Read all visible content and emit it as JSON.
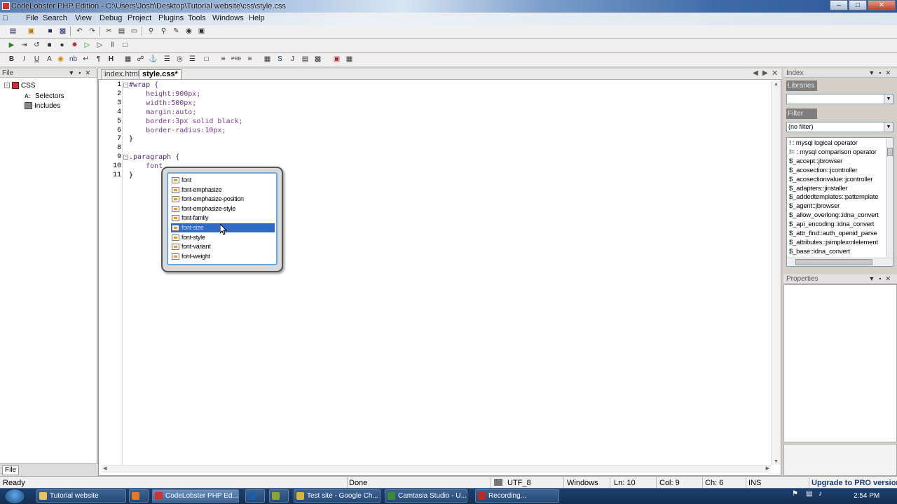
{
  "window": {
    "title": "CodeLobster PHP Edition - C:\\Users\\Josh\\Desktop\\Tutorial website\\css\\style.css"
  },
  "menu": [
    "File",
    "Edit",
    "Search",
    "View",
    "Debug",
    "Project",
    "Plugins",
    "Tools",
    "Windows",
    "Help"
  ],
  "left_panel": {
    "title": "File",
    "tree": [
      {
        "label": "CSS"
      },
      {
        "label": "Selectors"
      },
      {
        "label": "Includes"
      }
    ],
    "bottom_tab": "File"
  },
  "editor": {
    "tabs": [
      {
        "label": "index.html",
        "active": false
      },
      {
        "label": "style.css*",
        "active": true
      }
    ],
    "line_numbers": [
      "1",
      "2",
      "3",
      "4",
      "5",
      "6",
      "7",
      "8",
      "9",
      "10",
      "11"
    ],
    "lines": [
      "#wrap {",
      "    height:900px;",
      "    width:500px;",
      "    margin:auto;",
      "    border:3px solid black;",
      "    border-radius:10px;",
      "}",
      "",
      ".paragraph {",
      "    font",
      "}"
    ]
  },
  "autocomplete": {
    "items": [
      "font",
      "font-emphasize",
      "font-emphasize-position",
      "font-emphasize-style",
      "font-family",
      "font-size",
      "font-style",
      "font-variant",
      "font-weight"
    ],
    "selected_index": 5
  },
  "index_panel": {
    "title": "Index",
    "libraries_label": "Libraries",
    "libraries_value": "",
    "filter_label": "Filter",
    "filter_value": "(no filter)",
    "entries": [
      "! : mysql logical operator",
      "!= : mysql comparison operator",
      "$_accept::jbrowser",
      "$_acosection::jcontroller",
      "$_acosectionvalue::jcontroller",
      "$_adapters::jinstaller",
      "$_addedtemplates::pattemplate",
      "$_agent::jbrowser",
      "$_allow_overlong::idna_convert",
      "$_api_encoding::idna_convert",
      "$_attr_find::auth_openid_parse",
      "$_attributes::jsimplexmlelement",
      "$_base::idna_convert",
      "$_basepath::jcontroller"
    ]
  },
  "properties_panel": {
    "title": "Properties"
  },
  "statusbar": {
    "ready": "Ready",
    "done": "Done",
    "encoding": "UTF_8",
    "line_ending": "Windows",
    "ln": "Ln: 10",
    "col": "Col: 9",
    "ch": "Ch: 6",
    "mode": "INS",
    "upgrade": "Upgrade to PRO version"
  },
  "taskbar": {
    "tasks": [
      {
        "label": "Tutorial website"
      },
      {
        "label": "CodeLobster PHP Ed..."
      },
      {
        "label": "Test site - Google Ch..."
      },
      {
        "label": "Camtasia Studio - U..."
      },
      {
        "label": "Recording..."
      }
    ],
    "clock": "2:54 PM"
  },
  "colors": {
    "selection": "#316ac5",
    "popup_border": "#6aa8e0"
  }
}
